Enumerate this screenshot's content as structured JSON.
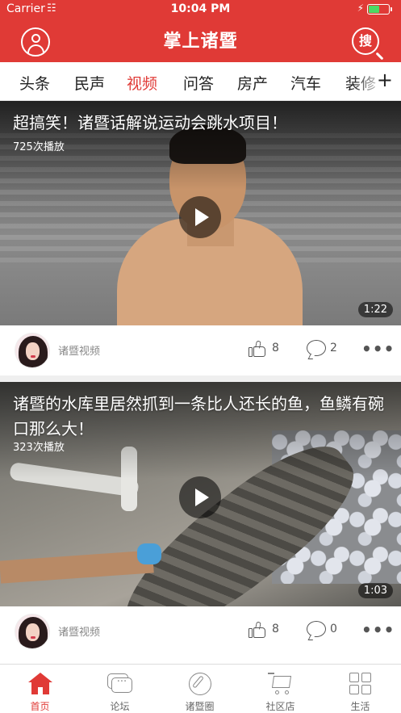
{
  "status_bar": {
    "carrier": "Carrier",
    "time": "10:04 PM",
    "battery_level": 0.55
  },
  "header": {
    "title": "掌上诸暨",
    "search_label": "搜"
  },
  "tabs": [
    {
      "label": "头条",
      "active": false
    },
    {
      "label": "民声",
      "active": false
    },
    {
      "label": "视频",
      "active": true
    },
    {
      "label": "问答",
      "active": false
    },
    {
      "label": "房产",
      "active": false
    },
    {
      "label": "汽车",
      "active": false
    },
    {
      "label": "装修",
      "active": false
    }
  ],
  "tabs_more": "+",
  "videos": [
    {
      "title": "超搞笑！诸暨话解说运动会跳水项目！",
      "play_count": "725次播放",
      "duration": "1:22",
      "source": "诸暨视频",
      "likes": "8",
      "comments": "2"
    },
    {
      "title": "诸暨的水库里居然抓到一条比人还长的鱼，鱼鳞有碗口那么大！",
      "play_count": "323次播放",
      "duration": "1:03",
      "source": "诸暨视频",
      "likes": "8",
      "comments": "0"
    }
  ],
  "more_label": "•••",
  "bottom_nav": [
    {
      "label": "首页",
      "icon": "home-icon",
      "active": true
    },
    {
      "label": "论坛",
      "icon": "forum-icon",
      "active": false
    },
    {
      "label": "诸暨圈",
      "icon": "compass-icon",
      "active": false
    },
    {
      "label": "社区店",
      "icon": "cart-icon",
      "active": false
    },
    {
      "label": "生活",
      "icon": "grid-icon",
      "active": false
    }
  ],
  "colors": {
    "brand": "#e03a36",
    "active_tab": "#e03a36",
    "battery": "#4cd964"
  }
}
